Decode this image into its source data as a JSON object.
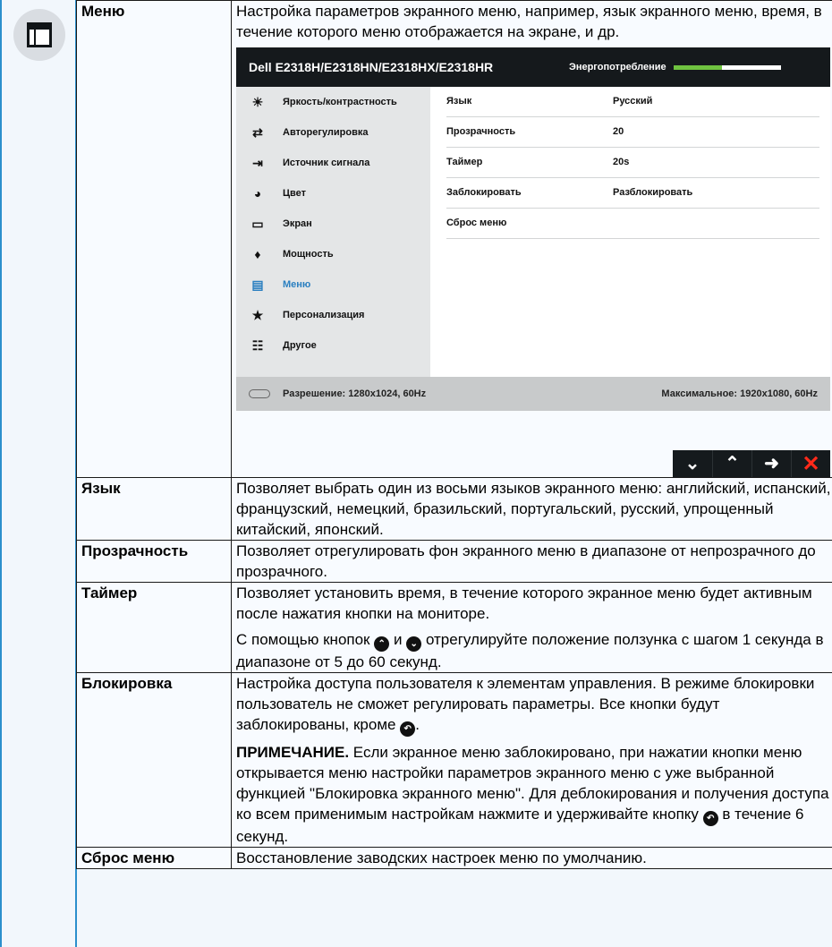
{
  "rows": [
    {
      "term": "Меню",
      "desc": "Настройка параметров экранного меню, например, язык экранного меню, время, в течение которого меню отображается на экране, и др."
    },
    {
      "term": "Язык",
      "desc": "Позволяет выбрать один из восьми языков экранного меню: английский, испанский, французский, немецкий, бразильский, португальский, русский, упрощенный китайский, японский."
    },
    {
      "term": "Прозрачность",
      "desc": "Позволяет отрегулировать фон экранного меню в диапазоне от непрозрачного до прозрачного."
    },
    {
      "term": "Таймер",
      "desc": "Позволяет установить время, в течение которого экранное меню будет активным после нажатия кнопки на мониторе.",
      "desc2_a": "С помощью кнопок",
      "desc2_b": "и",
      "desc2_c": "отрегулируйте положение ползунка с шагом 1 секунда в диапазоне от 5 до 60 секунд."
    },
    {
      "term": "Блокировка",
      "desc": "Настройка доступа пользователя к элементам управления. В режиме блокировки пользователь не сможет регулировать параметры. Все кнопки будут заблокированы, кроме",
      "desc_end": ".",
      "note_label": "ПРИМЕЧАНИЕ.",
      "note": "Если экранное меню заблокировано, при нажатии кнопки меню открывается меню настройки параметров экранного меню с уже выбранной функцией \"Блокировка экранного меню\". Для деблокирования и получения доступа ко всем применимым настройкам нажмите и удерживайте кнопку",
      "note_end": "в течение 6 секунд."
    },
    {
      "term": "Сброс меню",
      "desc": "Восстановление заводских настроек меню по умолчанию."
    }
  ],
  "osd": {
    "model": "Dell E2318H/E2318HN/E2318HX/E2318HR",
    "power_label": "Энергопотребление",
    "power_level": 0.45,
    "menu": [
      {
        "label": "Яркость/контрастность",
        "icon": "brightness-icon"
      },
      {
        "label": "Авторегулировка",
        "icon": "auto-adjust-icon"
      },
      {
        "label": "Источник сигнала",
        "icon": "input-source-icon"
      },
      {
        "label": "Цвет",
        "icon": "color-icon"
      },
      {
        "label": "Экран",
        "icon": "display-icon"
      },
      {
        "label": "Мощность",
        "icon": "power-icon"
      },
      {
        "label": "Меню",
        "icon": "menu-icon"
      },
      {
        "label": "Персонализация",
        "icon": "star-icon"
      },
      {
        "label": "Другое",
        "icon": "others-icon"
      }
    ],
    "settings": [
      {
        "key": "Язык",
        "value": "Русский"
      },
      {
        "key": "Прозрачность",
        "value": "20"
      },
      {
        "key": "Таймер",
        "value": "20s"
      },
      {
        "key": "Заблокировать",
        "value": "Разблокировать"
      },
      {
        "key": "Сброс меню",
        "value": ""
      }
    ],
    "resolution": "Разрешение: 1280x1024, 60Hz",
    "max_resolution": "Максимальное: 1920x1080, 60Hz",
    "buttons": [
      "down-button",
      "up-button",
      "next-button",
      "exit-button"
    ]
  },
  "colors": {
    "accent": "#2c8fcc",
    "active_menu": "#2a7fc0",
    "power_fill": "#6fc340",
    "exit": "#ff2a1a"
  }
}
